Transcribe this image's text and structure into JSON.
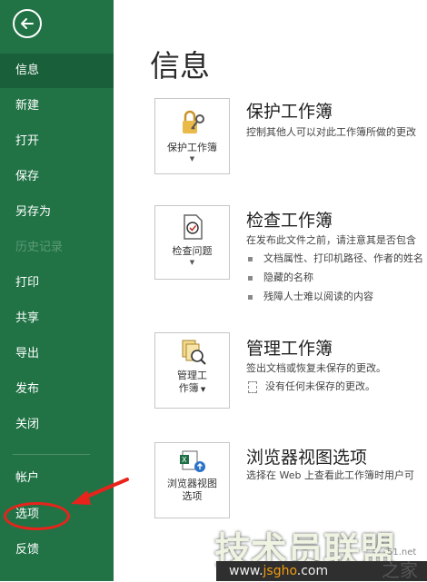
{
  "sidebar": {
    "items": [
      {
        "label": "信息",
        "state": "active"
      },
      {
        "label": "新建",
        "state": "normal"
      },
      {
        "label": "打开",
        "state": "normal"
      },
      {
        "label": "保存",
        "state": "normal"
      },
      {
        "label": "另存为",
        "state": "normal"
      },
      {
        "label": "历史记录",
        "state": "disabled"
      },
      {
        "label": "打印",
        "state": "normal"
      },
      {
        "label": "共享",
        "state": "normal"
      },
      {
        "label": "导出",
        "state": "normal"
      },
      {
        "label": "发布",
        "state": "normal"
      },
      {
        "label": "关闭",
        "state": "normal"
      },
      {
        "label": "帐户",
        "state": "normal"
      },
      {
        "label": "选项",
        "state": "highlighted"
      },
      {
        "label": "反馈",
        "state": "normal"
      }
    ]
  },
  "main": {
    "title": "信息",
    "sections": [
      {
        "card_label": "保护工作簿",
        "card_icon": "lock-key-icon",
        "title": "保护工作簿",
        "description": "控制其他人可以对此工作簿所做的更改",
        "bullets": []
      },
      {
        "card_label": "检查问题",
        "card_icon": "inspect-document-icon",
        "title": "检查工作簿",
        "description": "在发布此文件之前，请注意其是否包含",
        "bullets": [
          "文档属性、打印机路径、作者的姓名",
          "隐藏的名称",
          "残障人士难以阅读的内容"
        ]
      },
      {
        "card_label_line1": "管理工",
        "card_label_line2": "作簿",
        "card_icon": "manage-workbook-icon",
        "title": "管理工作簿",
        "description": "签出文档或恢复未保存的更改。",
        "note": "没有任何未保存的更改。"
      },
      {
        "card_label_line1": "浏览器视图",
        "card_label_line2": "选项",
        "card_icon": "browser-view-icon",
        "title": "浏览器视图选项",
        "description": "选择在 Web 上查看此工作簿时用户可"
      }
    ]
  },
  "watermark": {
    "text": "技术员联盟",
    "url_prefix": "www.",
    "url_accent": "jsgho",
    "url_suffix": ".com",
    "home": "之家",
    "number": "51.net"
  },
  "colors": {
    "sidebar": "#217346",
    "active": "#19603a",
    "annotation": "#e8231b"
  }
}
